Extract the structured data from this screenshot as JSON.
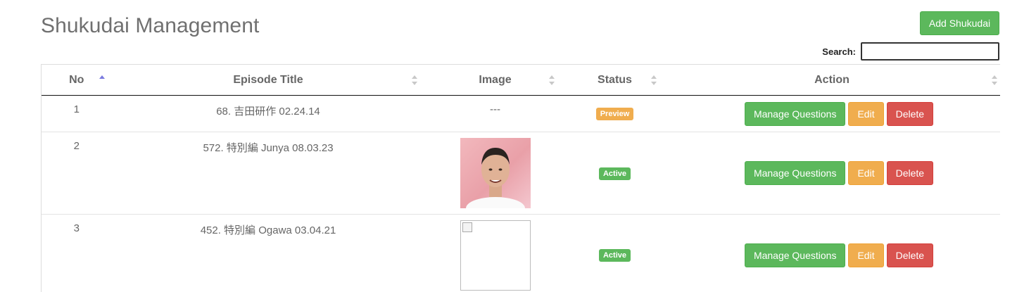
{
  "page": {
    "title": "Shukudai Management",
    "add_button": "Add Shukudai"
  },
  "search": {
    "label": "Search:",
    "value": ""
  },
  "table": {
    "columns": [
      "No",
      "Episode Title",
      "Image",
      "Status",
      "Action"
    ],
    "rows": [
      {
        "no": "1",
        "title": "68. 吉田研作 02.24.14",
        "image": "---",
        "status": "Preview"
      },
      {
        "no": "2",
        "title": "572. 特別編 Junya 08.03.23",
        "image": "photo",
        "status": "Active"
      },
      {
        "no": "3",
        "title": "452. 特別編 Ogawa 03.04.21",
        "image": "broken",
        "status": "Active"
      }
    ],
    "action_labels": {
      "manage": "Manage Questions",
      "edit": "Edit",
      "delete": "Delete"
    }
  },
  "colors": {
    "success": "#5cb85c",
    "warning": "#f0ad4e",
    "danger": "#d9534f"
  }
}
